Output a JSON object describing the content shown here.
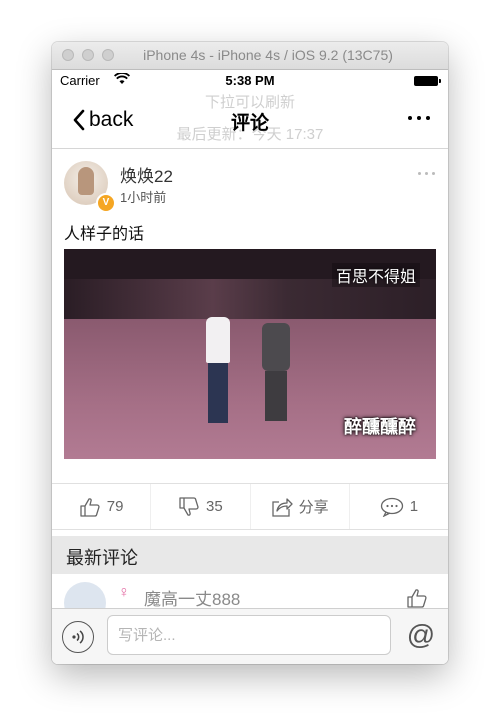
{
  "simulator": {
    "window_title": "iPhone 4s - iPhone 4s / iOS 9.2 (13C75)"
  },
  "status_bar": {
    "carrier": "Carrier",
    "time": "5:38 PM"
  },
  "refresh_overlay": {
    "line1": "下拉可以刷新",
    "line2": "最后更新：今天 17:37"
  },
  "nav": {
    "back_label": "back",
    "title": "评论"
  },
  "post": {
    "username": "焕焕22",
    "time": "1小时前",
    "text": "人样子的话",
    "video_caption_top": "百思不得姐",
    "video_caption_bottom": "醉醺醺醉"
  },
  "actions": {
    "like_count": "79",
    "dislike_count": "35",
    "share_label": "分享",
    "comment_count": "1"
  },
  "comments_section": {
    "header": "最新评论",
    "items": [
      {
        "gender": "♀",
        "name": "魔高一丈888"
      }
    ]
  },
  "input_bar": {
    "placeholder": "写评论..."
  },
  "icons": {
    "back": "chevron-left-icon",
    "more": "ellipsis-icon",
    "like": "thumbs-up-icon",
    "dislike": "thumbs-down-icon",
    "share": "share-icon",
    "comment": "speech-bubble-icon",
    "voice": "voice-icon",
    "at": "at-icon"
  },
  "colors": {
    "badge": "#f5a623",
    "female": "#e46fa5",
    "section_bg": "#e8e8e8"
  }
}
